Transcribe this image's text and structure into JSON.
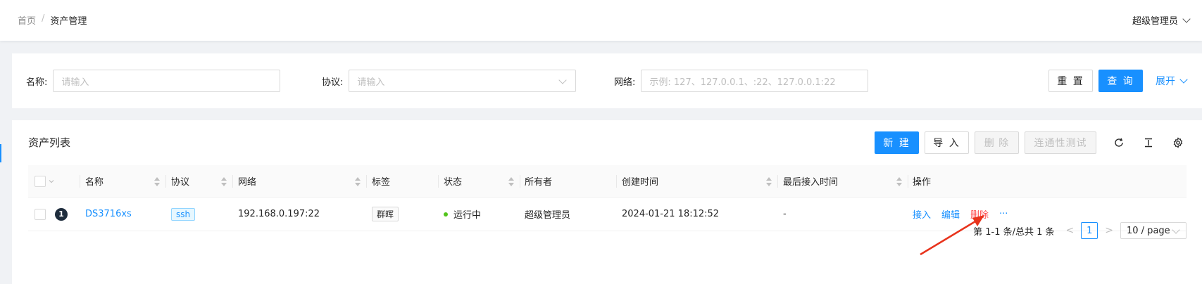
{
  "header": {
    "breadcrumb": {
      "home": "首页",
      "separator": "/",
      "current": "资产管理"
    },
    "user": {
      "name": "超级管理员",
      "icon": "chevron-down-icon"
    }
  },
  "search": {
    "name_label": "名称:",
    "name_placeholder": "请输入",
    "protocol_label": "协议:",
    "protocol_placeholder": "请输入",
    "network_label": "网络:",
    "network_placeholder": "示例: 127、127.0.0.1、:22、127.0.0.1:22",
    "reset_label": "重 置",
    "query_label": "查 询",
    "expand_label": "展开"
  },
  "table": {
    "title": "资产列表",
    "toolbar": {
      "new_label": "新 建",
      "import_label": "导 入",
      "delete_label": "删 除",
      "connectivity_label": "连通性测试",
      "icons": [
        "refresh-icon",
        "density-icon",
        "settings-icon"
      ]
    },
    "columns": [
      "名称",
      "协议",
      "网络",
      "标签",
      "状态",
      "所有者",
      "创建时间",
      "最后接入时间",
      "操作"
    ],
    "rows": [
      {
        "index": "1",
        "name": "DS3716xs",
        "protocol": "ssh",
        "network": "192.168.0.197:22",
        "tag": "群晖",
        "status": "运行中",
        "owner": "超级管理员",
        "created": "2024-01-21 18:12:52",
        "last_access": "-",
        "actions": {
          "connect": "接入",
          "edit": "编辑",
          "delete": "删除",
          "more": "···"
        }
      }
    ],
    "pagination": {
      "summary": "第 1-1 条/总共 1 条",
      "current_page": "1",
      "page_size": "10 / page",
      "prev": "<",
      "next": ">"
    }
  },
  "colors": {
    "primary": "#1890ff",
    "danger": "#ff4d4f",
    "success": "#52c41a",
    "annotation_arrow": "#e8331c"
  }
}
